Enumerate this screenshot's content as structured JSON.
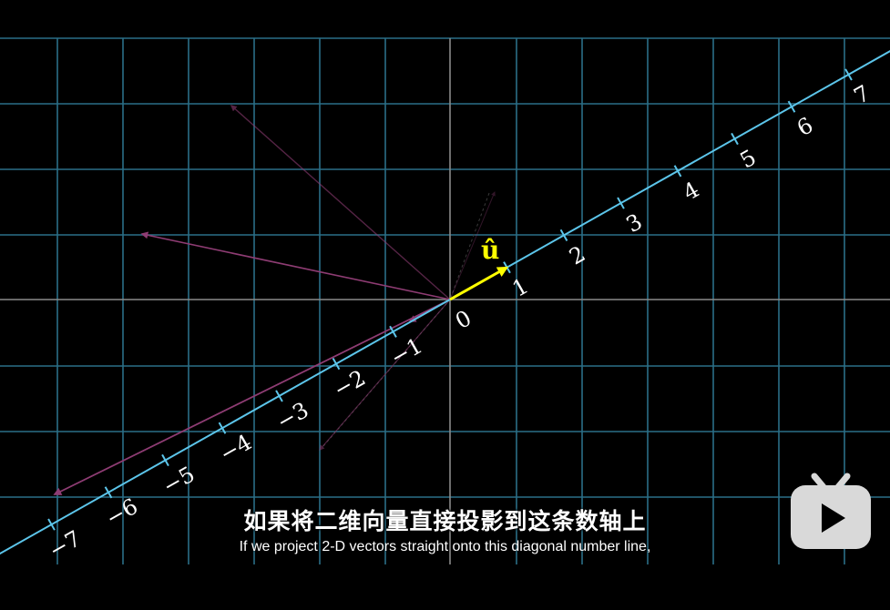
{
  "subtitle": {
    "zh": "如果将二维向量直接投影到这条数轴上",
    "en": "If we project 2-D vectors straight onto this diagonal number line,"
  },
  "unit_vector_label": "û",
  "number_line_labels": [
    "−7",
    "−6",
    "−5",
    "−4",
    "−3",
    "−2",
    "−1",
    "0",
    "1",
    "2",
    "3",
    "4",
    "5",
    "6",
    "7"
  ],
  "colors": {
    "grid": "#2b6f87",
    "axis": "#8a8a8a",
    "number_line": "#5cc5ea",
    "vector": "#8e3c73",
    "unit_vector": "#ffff00",
    "background": "#000000"
  },
  "icons": [
    "bilibili-tv-logo-icon"
  ]
}
